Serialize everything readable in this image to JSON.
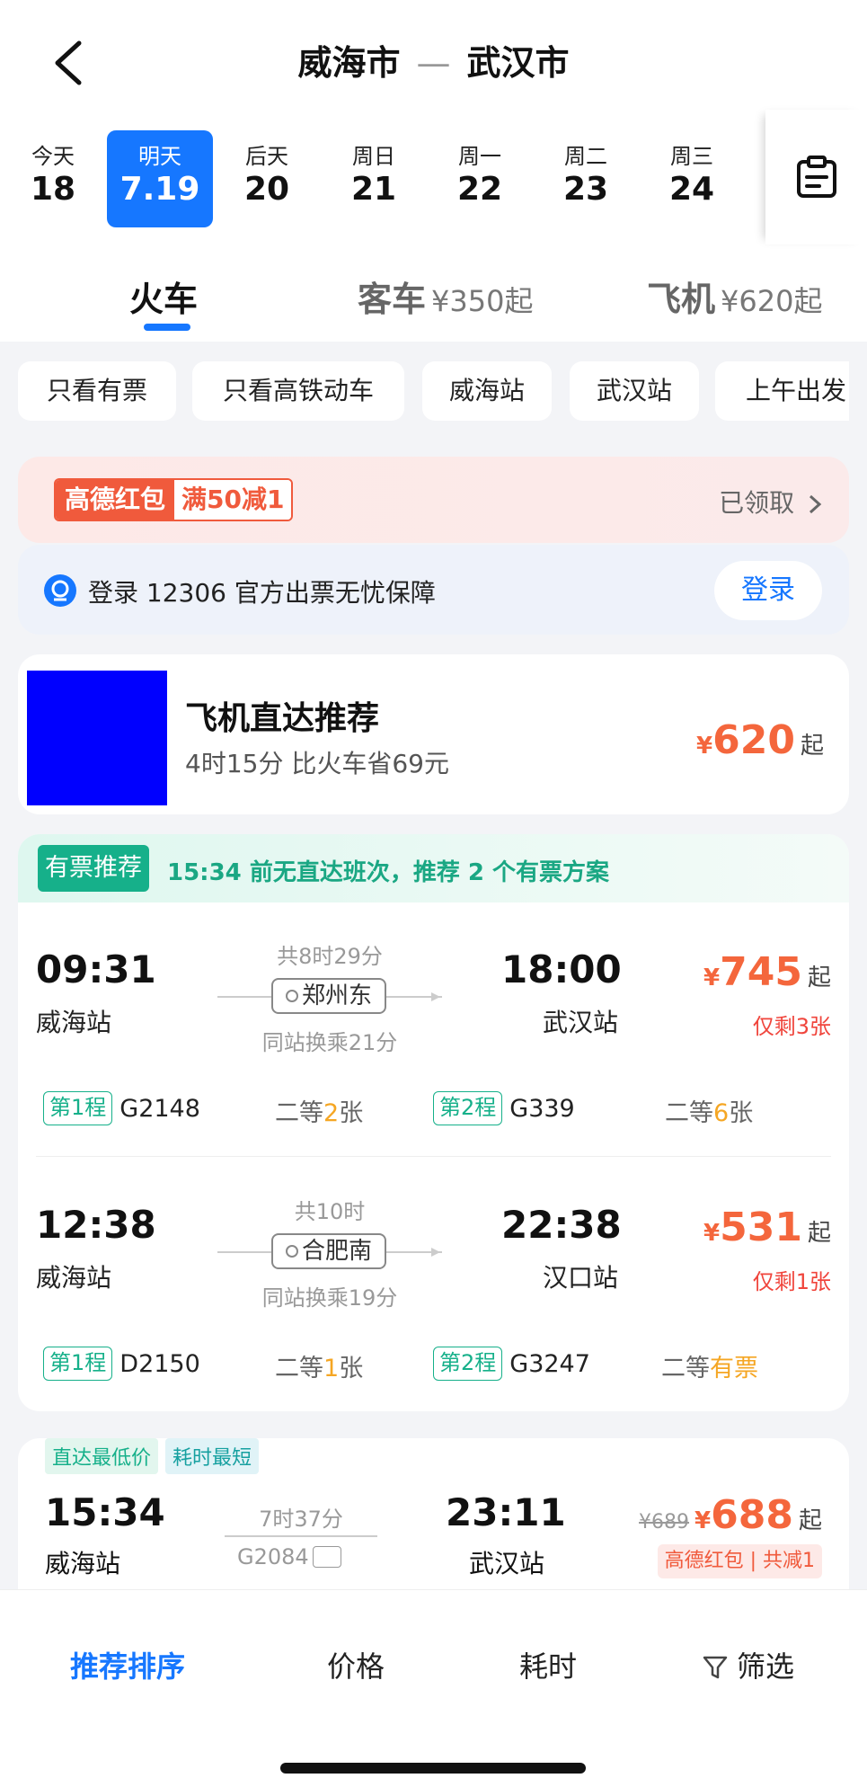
{
  "header": {
    "from": "威海市",
    "to": "武汉市",
    "separator": "—"
  },
  "dates": [
    {
      "label": "今天",
      "num": "18"
    },
    {
      "label": "明天",
      "num": "7.19"
    },
    {
      "label": "后天",
      "num": "20"
    },
    {
      "label": "周日",
      "num": "21"
    },
    {
      "label": "周一",
      "num": "22"
    },
    {
      "label": "周二",
      "num": "23"
    },
    {
      "label": "周三",
      "num": "24"
    }
  ],
  "modes": {
    "train": "火车",
    "bus": "客车",
    "bus_price": "¥350起",
    "plane": "飞机",
    "plane_price": "¥620起"
  },
  "filters": [
    "只看有票",
    "只看高铁动车",
    "威海站",
    "武汉站",
    "上午出发"
  ],
  "redpack": {
    "a": "高德红包",
    "b": "满50减1",
    "status": "已领取"
  },
  "login": {
    "text": "登录 12306 官方出票无忧保障",
    "button": "登录"
  },
  "flight": {
    "title": "飞机直达推荐",
    "sub": "4时15分 比火车省69元",
    "currency": "¥",
    "price": "620",
    "suffix": "起"
  },
  "recommend": {
    "tag": "有票推荐",
    "text": "15:34 前无直达班次，推荐 2 个有票方案",
    "trips": [
      {
        "dep": "09:31",
        "dep_station": "威海站",
        "arr": "18:00",
        "arr_station": "武汉站",
        "duration": "共8时29分",
        "via": "郑州东",
        "xfer": "同站换乘21分",
        "currency": "¥",
        "price": "745",
        "suffix": "起",
        "left": "仅剩3张",
        "leg1_tag": "第1程",
        "leg1_no": "G2148",
        "leg1_seat": "二等",
        "leg1_n": "2",
        "leg1_unit": "张",
        "leg2_tag": "第2程",
        "leg2_no": "G339",
        "leg2_seat": "二等",
        "leg2_n": "6",
        "leg2_unit": "张"
      },
      {
        "dep": "12:38",
        "dep_station": "威海站",
        "arr": "22:38",
        "arr_station": "汉口站",
        "duration": "共10时",
        "via": "合肥南",
        "xfer": "同站换乘19分",
        "currency": "¥",
        "price": "531",
        "suffix": "起",
        "left": "仅剩1张",
        "leg1_tag": "第1程",
        "leg1_no": "D2150",
        "leg1_seat": "二等",
        "leg1_n": "1",
        "leg1_unit": "张",
        "leg2_tag": "第2程",
        "leg2_no": "G3247",
        "leg2_seat": "二等",
        "leg2_n": "有票",
        "leg2_unit": ""
      }
    ]
  },
  "direct": {
    "tag1": "直达最低价",
    "tag2": "耗时最短",
    "dep": "15:34",
    "dep_station": "威海站",
    "arr": "23:11",
    "arr_station": "武汉站",
    "duration": "7时37分",
    "code": "G2084",
    "old_price": "¥689",
    "currency": "¥",
    "price": "688",
    "suffix": "起",
    "redpack": "高德红包 | 共减1"
  },
  "bottom": {
    "sort": "推荐排序",
    "price": "价格",
    "time": "耗时",
    "filter": "筛选"
  },
  "colors": {
    "accent": "#1677ff",
    "price": "#f4663c",
    "green": "#16b08a"
  }
}
